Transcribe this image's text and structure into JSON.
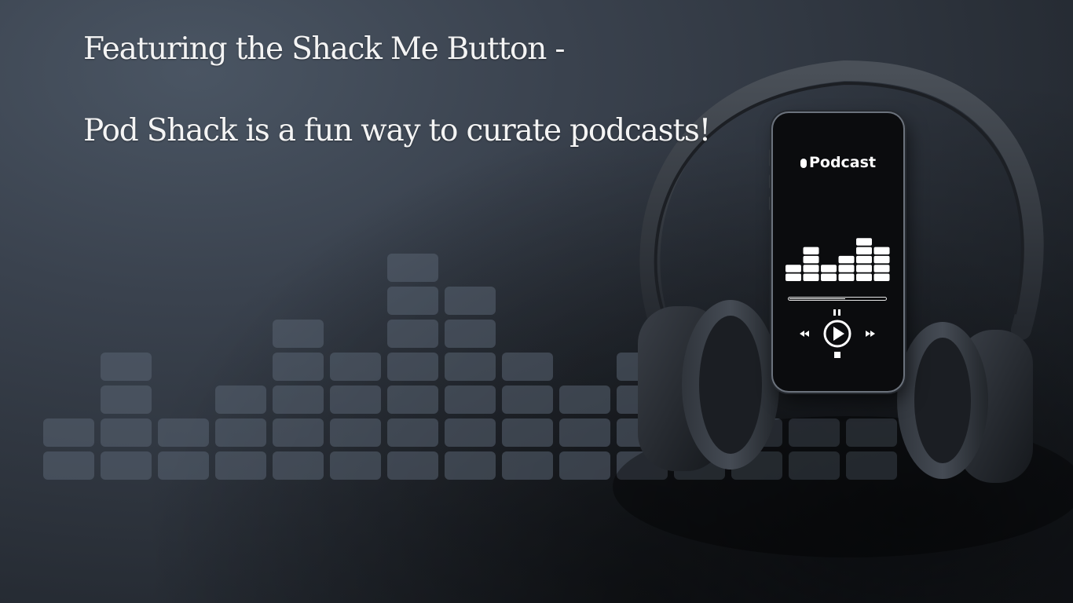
{
  "headline": {
    "line1": "Featuring the Shack Me Button -",
    "line2": "Pod Shack is a fun way to curate podcasts!"
  },
  "phone_screen": {
    "title": "Podcast",
    "playback_progress": 0.58
  },
  "colors": {
    "headline_text": "#f4f4f4",
    "background": "#2c323b",
    "phone_screen": "#0b0c0e",
    "ui_white": "#ffffff"
  },
  "icons": [
    "microphone-icon",
    "rewind-icon",
    "play-icon",
    "fast-forward-icon",
    "pause-icon",
    "stop-icon"
  ]
}
